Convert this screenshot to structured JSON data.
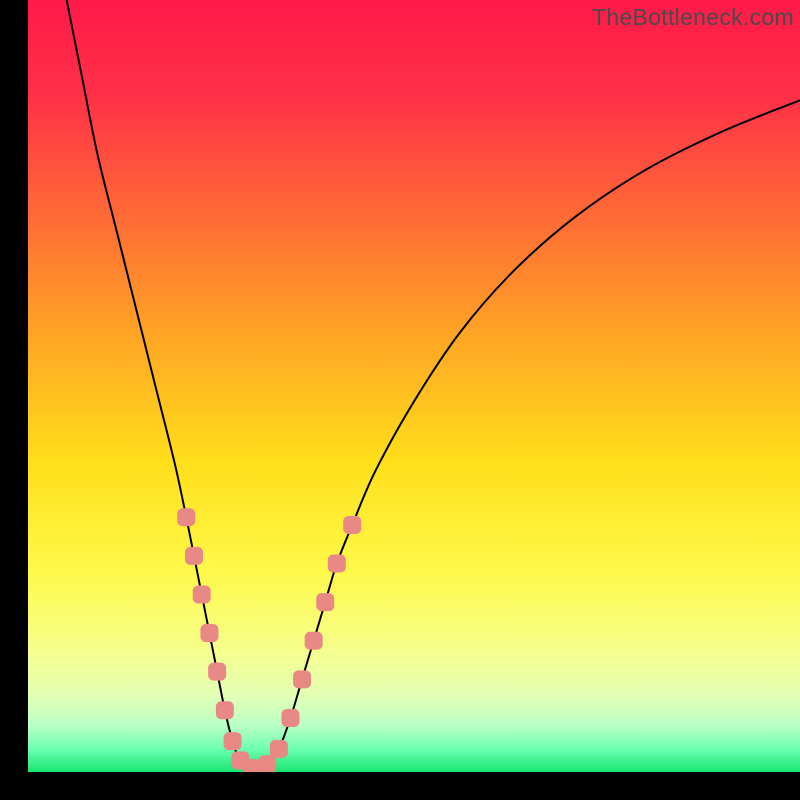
{
  "watermark": "TheBottleneck.com",
  "chart_data": {
    "type": "line",
    "title": "",
    "xlabel": "",
    "ylabel": "",
    "xlim": [
      0,
      100
    ],
    "ylim": [
      0,
      100
    ],
    "background_gradient": {
      "stops": [
        {
          "offset": 0.0,
          "color": "#ff1a4a"
        },
        {
          "offset": 0.12,
          "color": "#ff2f47"
        },
        {
          "offset": 0.28,
          "color": "#ff6a36"
        },
        {
          "offset": 0.44,
          "color": "#ffa724"
        },
        {
          "offset": 0.6,
          "color": "#ffdf1a"
        },
        {
          "offset": 0.74,
          "color": "#fff94a"
        },
        {
          "offset": 0.84,
          "color": "#f6ff8a"
        },
        {
          "offset": 0.9,
          "color": "#e4ffb4"
        },
        {
          "offset": 0.94,
          "color": "#b9ffc6"
        },
        {
          "offset": 0.97,
          "color": "#6dffb2"
        },
        {
          "offset": 1.0,
          "color": "#17e66f"
        }
      ]
    },
    "curve": {
      "description": "V-shaped bottleneck curve: steep descent from top-left to a minimum near x≈27, then shallower rise toward top-right",
      "points": [
        {
          "x": 5.0,
          "y": 100.0
        },
        {
          "x": 7.0,
          "y": 90.0
        },
        {
          "x": 9.0,
          "y": 80.0
        },
        {
          "x": 11.5,
          "y": 70.0
        },
        {
          "x": 14.0,
          "y": 60.0
        },
        {
          "x": 16.5,
          "y": 50.0
        },
        {
          "x": 19.0,
          "y": 40.0
        },
        {
          "x": 20.5,
          "y": 33.0
        },
        {
          "x": 21.5,
          "y": 28.0
        },
        {
          "x": 22.5,
          "y": 23.0
        },
        {
          "x": 23.5,
          "y": 18.0
        },
        {
          "x": 24.5,
          "y": 13.0
        },
        {
          "x": 25.5,
          "y": 8.0
        },
        {
          "x": 26.5,
          "y": 4.0
        },
        {
          "x": 27.5,
          "y": 1.5
        },
        {
          "x": 29.0,
          "y": 0.5
        },
        {
          "x": 31.0,
          "y": 1.0
        },
        {
          "x": 32.5,
          "y": 3.0
        },
        {
          "x": 34.0,
          "y": 7.0
        },
        {
          "x": 35.5,
          "y": 12.0
        },
        {
          "x": 37.0,
          "y": 17.0
        },
        {
          "x": 38.5,
          "y": 22.0
        },
        {
          "x": 40.0,
          "y": 27.0
        },
        {
          "x": 42.0,
          "y": 32.0
        },
        {
          "x": 45.0,
          "y": 39.0
        },
        {
          "x": 50.0,
          "y": 48.0
        },
        {
          "x": 56.0,
          "y": 57.0
        },
        {
          "x": 63.0,
          "y": 65.0
        },
        {
          "x": 71.0,
          "y": 72.0
        },
        {
          "x": 80.0,
          "y": 78.0
        },
        {
          "x": 90.0,
          "y": 83.0
        },
        {
          "x": 100.0,
          "y": 87.0
        }
      ]
    },
    "markers": {
      "color": "#e98986",
      "radius_px": 9,
      "points": [
        {
          "x": 20.5,
          "y": 33.0
        },
        {
          "x": 21.5,
          "y": 28.0
        },
        {
          "x": 22.5,
          "y": 23.0
        },
        {
          "x": 23.5,
          "y": 18.0
        },
        {
          "x": 24.5,
          "y": 13.0
        },
        {
          "x": 25.5,
          "y": 8.0
        },
        {
          "x": 26.5,
          "y": 4.0
        },
        {
          "x": 27.5,
          "y": 1.5
        },
        {
          "x": 29.0,
          "y": 0.5
        },
        {
          "x": 31.0,
          "y": 1.0
        },
        {
          "x": 32.5,
          "y": 3.0
        },
        {
          "x": 34.0,
          "y": 7.0
        },
        {
          "x": 35.5,
          "y": 12.0
        },
        {
          "x": 37.0,
          "y": 17.0
        },
        {
          "x": 38.5,
          "y": 22.0
        },
        {
          "x": 40.0,
          "y": 27.0
        },
        {
          "x": 42.0,
          "y": 32.0
        }
      ]
    }
  }
}
